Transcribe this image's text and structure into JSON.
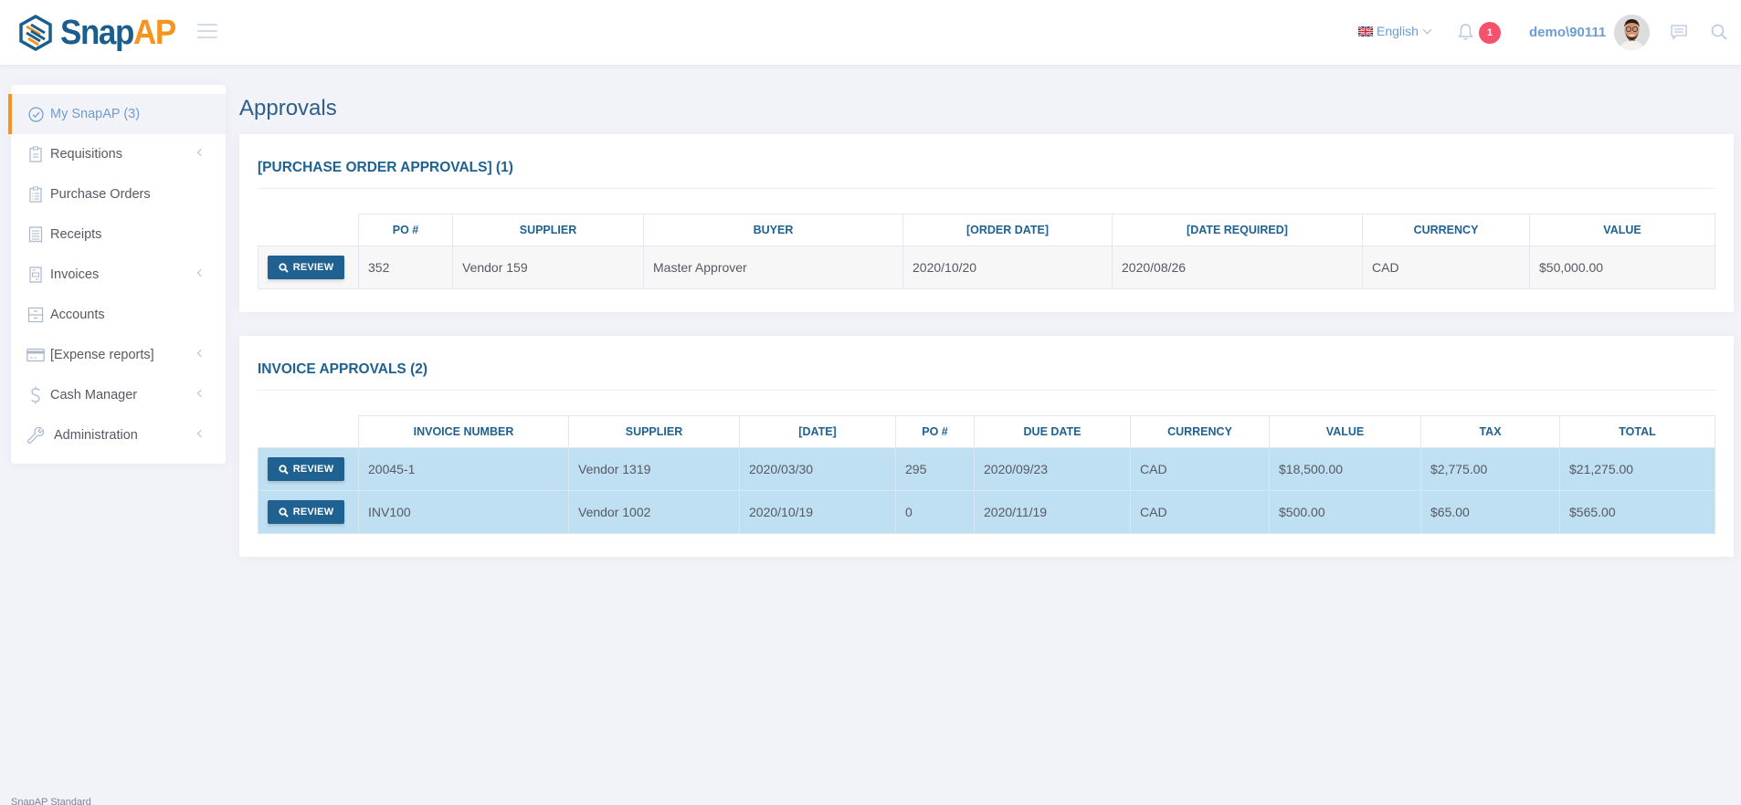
{
  "header": {
    "brand_part1": "Snap",
    "brand_part2": "AP",
    "language": "English",
    "notification_count": "1",
    "username": "demo\\90111",
    "icons": [
      "logo-icon",
      "hamburger-icon",
      "uk-flag-icon",
      "chevron-down-icon",
      "bell-icon",
      "avatar",
      "chat-icon",
      "search-icon"
    ]
  },
  "sidebar": {
    "items": [
      {
        "label": "My SnapAP (3)",
        "icon": "check-circle-icon",
        "active": true,
        "has_arrow": false
      },
      {
        "label": "Requisitions",
        "icon": "clipboard-icon",
        "active": false,
        "has_arrow": true
      },
      {
        "label": "Purchase Orders",
        "icon": "clipboard-list-icon",
        "active": false,
        "has_arrow": false
      },
      {
        "label": "Receipts",
        "icon": "receipt-icon",
        "active": false,
        "has_arrow": false
      },
      {
        "label": "Invoices",
        "icon": "invoice-icon",
        "active": false,
        "has_arrow": true
      },
      {
        "label": "Accounts",
        "icon": "archive-icon",
        "active": false,
        "has_arrow": false
      },
      {
        "label": "[Expense reports]",
        "icon": "credit-card-icon",
        "active": false,
        "has_arrow": true
      },
      {
        "label": "Cash Manager",
        "icon": "dollar-icon",
        "active": false,
        "has_arrow": true
      },
      {
        "label": "Administration",
        "icon": "wrench-icon",
        "active": false,
        "has_arrow": true
      }
    ]
  },
  "main": {
    "title": "Approvals",
    "po_section": {
      "title": "[PURCHASE ORDER APPROVALS] (1)",
      "columns": [
        "PO #",
        "SUPPLIER",
        "BUYER",
        "[ORDER DATE]",
        "[DATE REQUIRED]",
        "CURRENCY",
        "VALUE"
      ],
      "rows": [
        {
          "action": "REVIEW",
          "cells": [
            "352",
            "Vendor 159",
            "Master Approver",
            "2020/10/20",
            "2020/08/26",
            "CAD",
            "$50,000.00"
          ]
        }
      ]
    },
    "invoice_section": {
      "title": "INVOICE APPROVALS (2)",
      "columns": [
        "INVOICE NUMBER",
        "SUPPLIER",
        "[DATE]",
        "PO #",
        "DUE DATE",
        "CURRENCY",
        "VALUE",
        "TAX",
        "TOTAL"
      ],
      "rows": [
        {
          "action": "REVIEW",
          "cells": [
            "20045-1",
            "Vendor 1319",
            "2020/03/30",
            "295",
            "2020/09/23",
            "CAD",
            "$18,500.00",
            "$2,775.00",
            "$21,275.00"
          ]
        },
        {
          "action": "REVIEW",
          "cells": [
            "INV100",
            "Vendor 1002",
            "2020/10/19",
            "0",
            "2020/11/19",
            "CAD",
            "$500.00",
            "$65.00",
            "$565.00"
          ]
        }
      ]
    }
  },
  "footer": {
    "text": "SnapAP Standard"
  },
  "colors": {
    "brand_blue": "#1b5d8c",
    "brand_orange": "#f7941d",
    "heading_blue": "#1f6190",
    "link_blue": "#6d9dd1",
    "badge_red": "#f4516c",
    "highlight_row": "#bfdff2",
    "page_bg": "#f2f3f8"
  }
}
